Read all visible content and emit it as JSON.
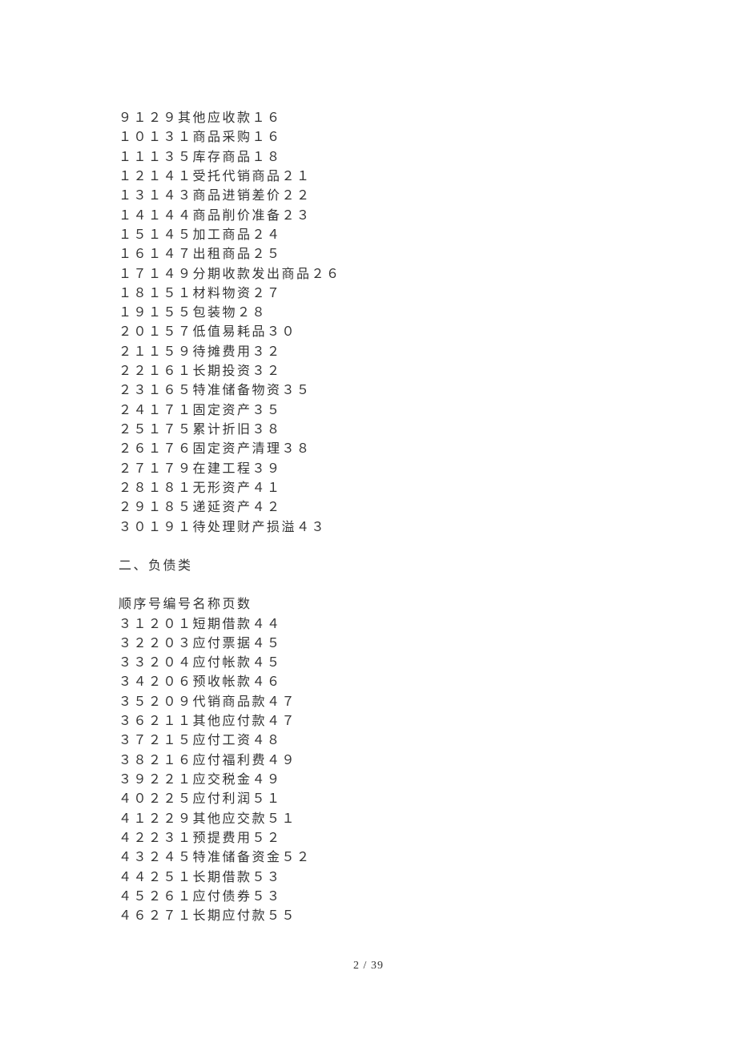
{
  "block1": {
    "items": [
      {
        "seq": "９",
        "code": "１２９",
        "name": "其他应收款",
        "page": "１６"
      },
      {
        "seq": "１０",
        "code": "１３１",
        "name": "商品采购",
        "page": "１６"
      },
      {
        "seq": "１１",
        "code": "１３５",
        "name": "库存商品",
        "page": "１８"
      },
      {
        "seq": "１２",
        "code": "１４１",
        "name": "受托代销商品",
        "page": "２１"
      },
      {
        "seq": "１３",
        "code": "１４３",
        "name": "商品进销差价",
        "page": "２２"
      },
      {
        "seq": "１４",
        "code": "１４４",
        "name": "商品削价准备",
        "page": "２３"
      },
      {
        "seq": "１５",
        "code": "１４５",
        "name": "加工商品",
        "page": "２４"
      },
      {
        "seq": "１６",
        "code": "１４７",
        "name": "出租商品",
        "page": "２５"
      },
      {
        "seq": "１７",
        "code": "１４９",
        "name": "分期收款发出商品",
        "page": "２６"
      },
      {
        "seq": "１８",
        "code": "１５１",
        "name": "材料物资",
        "page": "２７"
      },
      {
        "seq": "１９",
        "code": "１５５",
        "name": "包装物",
        "page": "２８"
      },
      {
        "seq": "２０",
        "code": "１５７",
        "name": "低值易耗品",
        "page": "３０"
      },
      {
        "seq": "２１",
        "code": "１５９",
        "name": "待摊费用",
        "page": "３２"
      },
      {
        "seq": "２２",
        "code": "１６１",
        "name": "长期投资",
        "page": "３２"
      },
      {
        "seq": "２３",
        "code": "１６５",
        "name": "特准储备物资",
        "page": "３５"
      },
      {
        "seq": "２４",
        "code": "１７１",
        "name": "固定资产",
        "page": "３５"
      },
      {
        "seq": "２５",
        "code": "１７５",
        "name": "累计折旧",
        "page": "３８"
      },
      {
        "seq": "２６",
        "code": "１７６",
        "name": "固定资产清理",
        "page": "３８"
      },
      {
        "seq": "２７",
        "code": "１７９",
        "name": "在建工程",
        "page": "３９"
      },
      {
        "seq": "２８",
        "code": "１８１",
        "name": "无形资产",
        "page": "４１"
      },
      {
        "seq": "２９",
        "code": "１８５",
        "name": "递延资产",
        "page": "４２"
      },
      {
        "seq": "３０",
        "code": "１９１",
        "name": "待处理财产损溢",
        "page": "４３"
      }
    ]
  },
  "section2": {
    "title": "二、负债类",
    "header": "顺序号编号名称页数"
  },
  "block2": {
    "items": [
      {
        "seq": "３１",
        "code": "２０１",
        "name": "短期借款",
        "page": "４４"
      },
      {
        "seq": "３２",
        "code": "２０３",
        "name": "应付票据",
        "page": "４５"
      },
      {
        "seq": "３３",
        "code": "２０４",
        "name": "应付帐款",
        "page": "４５"
      },
      {
        "seq": "３４",
        "code": "２０６",
        "name": "预收帐款",
        "page": "４６"
      },
      {
        "seq": "３５",
        "code": "２０９",
        "name": "代销商品款",
        "page": "４７"
      },
      {
        "seq": "３６",
        "code": "２１１",
        "name": "其他应付款",
        "page": "４７"
      },
      {
        "seq": "３７",
        "code": "２１５",
        "name": "应付工资",
        "page": "４８"
      },
      {
        "seq": "３８",
        "code": "２１６",
        "name": "应付福利费",
        "page": "４９"
      },
      {
        "seq": "３９",
        "code": "２２１",
        "name": "应交税金",
        "page": "４９"
      },
      {
        "seq": "４０",
        "code": "２２５",
        "name": "应付利润",
        "page": "５１"
      },
      {
        "seq": "４１",
        "code": "２２９",
        "name": "其他应交款",
        "page": "５１"
      },
      {
        "seq": "４２",
        "code": "２３１",
        "name": "预提费用",
        "page": "５２"
      },
      {
        "seq": "４３",
        "code": "２４５",
        "name": "特准储备资金",
        "page": "５２"
      },
      {
        "seq": "４４",
        "code": "２５１",
        "name": "长期借款",
        "page": "５３"
      },
      {
        "seq": "４５",
        "code": "２６１",
        "name": "应付债券",
        "page": "５３"
      },
      {
        "seq": "４６",
        "code": "２７１",
        "name": "长期应付款",
        "page": "５５"
      }
    ]
  },
  "footer": {
    "page_current": "2",
    "page_sep": " / ",
    "page_total": "39"
  }
}
